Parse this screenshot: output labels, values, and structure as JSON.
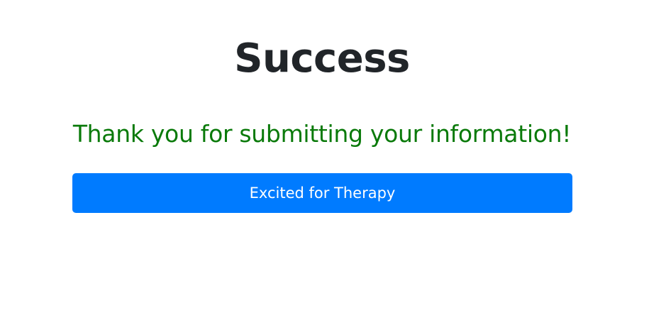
{
  "page": {
    "title": "Success",
    "message": "Thank you for submitting your information!",
    "button_label": "Excited for Therapy"
  },
  "colors": {
    "title": "#212529",
    "message": "#0a7a0a",
    "button_background": "#007bff",
    "button_text": "#ffffff",
    "page_background": "#ffffff"
  }
}
